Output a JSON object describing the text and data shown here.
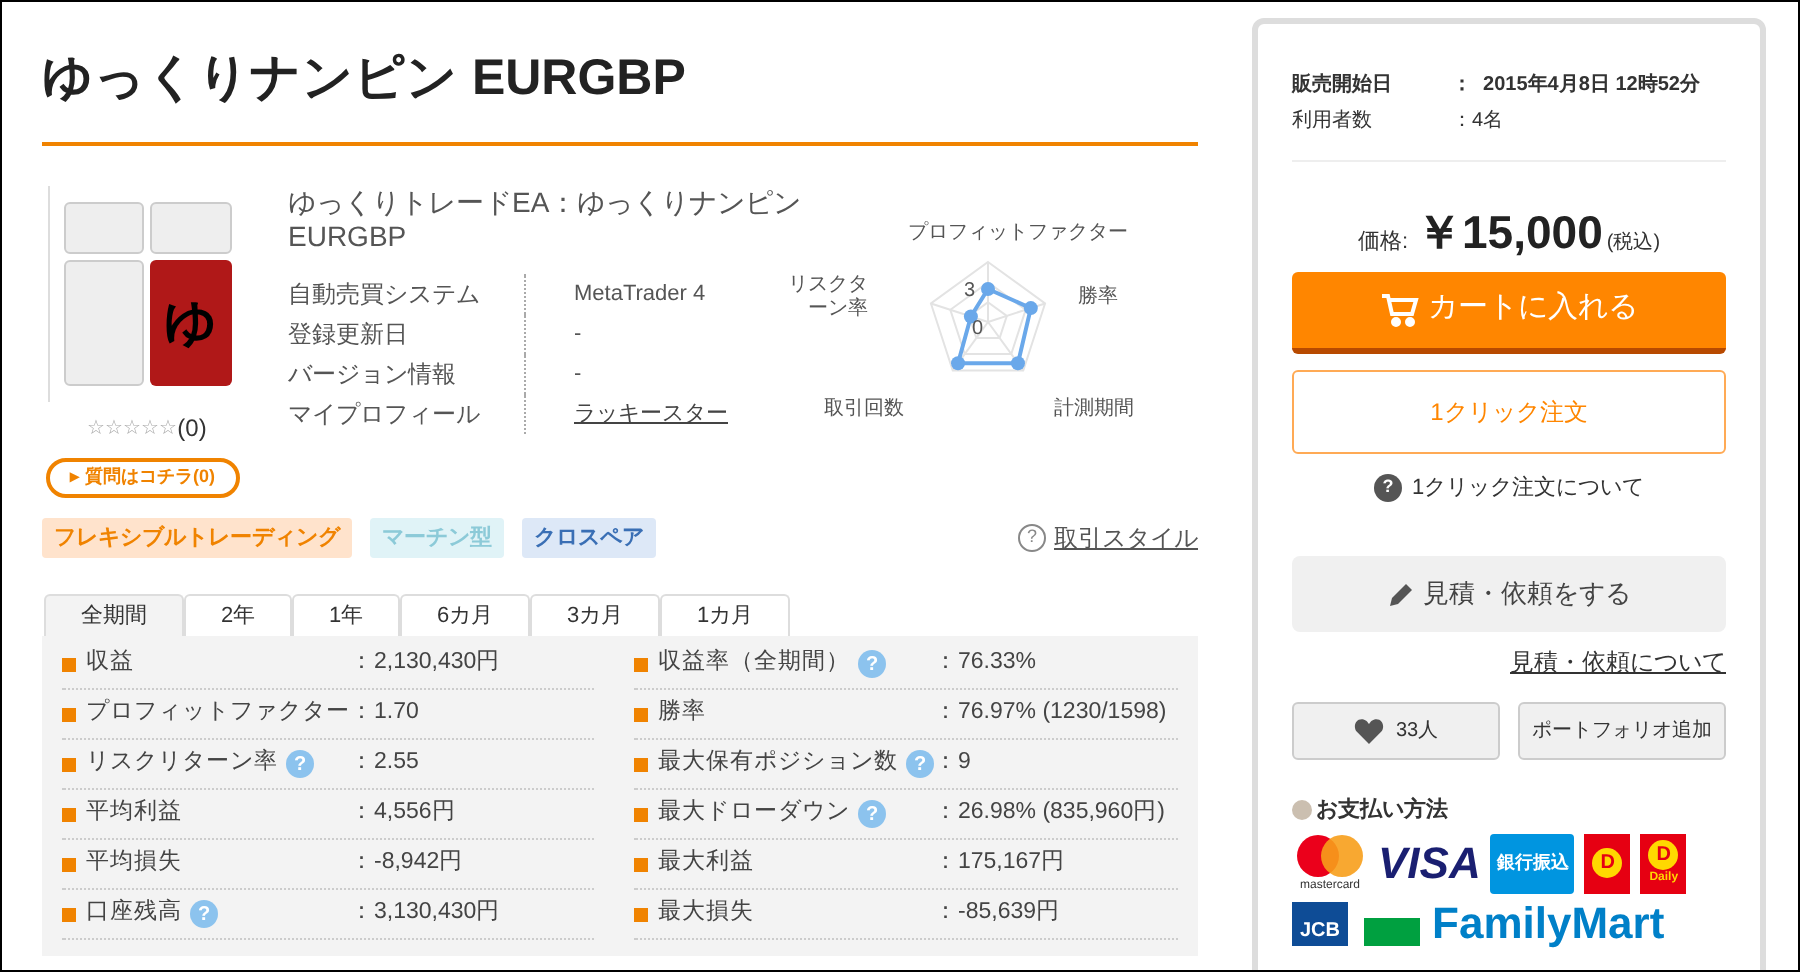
{
  "title": "ゆっくりナンピン EURGBP",
  "product": {
    "name": "ゆっくりトレードEA：ゆっくりナンピン EURGBP",
    "icon_letter": "ゆ",
    "stars": 0,
    "review_count": "(0)",
    "question_button": "質問はコチラ(0)",
    "question_arrow": "▸",
    "help_symbol": "?",
    "specs": [
      {
        "label": "自動売買システム",
        "value": "MetaTrader 4",
        "link": false
      },
      {
        "label": "登録更新日",
        "value": "-",
        "link": false
      },
      {
        "label": "バージョン情報",
        "value": "-",
        "link": false
      },
      {
        "label": "マイプロフィール",
        "value": "ラッキースター",
        "link": true
      }
    ]
  },
  "radar": {
    "labels": [
      "プロフィットファクター",
      "勝率",
      "計測期間",
      "取引回数",
      "リスクターン率"
    ],
    "ticks": [
      "3",
      "0"
    ]
  },
  "tags": [
    {
      "label": "フレキシブルトレーディング",
      "color": "#ffe3cc"
    },
    {
      "label": "マーチン型",
      "color": "#e0f3f7"
    },
    {
      "label": "クロスペア",
      "color": "#dde8f7"
    }
  ],
  "style_link": "取引スタイル",
  "tabs": [
    {
      "label": "全期間",
      "selected": true
    },
    {
      "label": "2年",
      "selected": false
    },
    {
      "label": "1年",
      "selected": false
    },
    {
      "label": "6カ月",
      "selected": false
    },
    {
      "label": "3カ月",
      "selected": false
    },
    {
      "label": "1カ月",
      "selected": false
    }
  ],
  "stats_left": [
    {
      "label": "収益",
      "value": "：2,130,430円",
      "help": false
    },
    {
      "label": "プロフィットファクター",
      "value": "：1.70",
      "help": false
    },
    {
      "label": "リスクリターン率",
      "value": "：2.55",
      "help": true
    },
    {
      "label": "平均利益",
      "value": "：4,556円",
      "help": false
    },
    {
      "label": "平均損失",
      "value": "：-8,942円",
      "help": false
    },
    {
      "label": "口座残高",
      "value": "：3,130,430円",
      "help": true
    }
  ],
  "stats_right": [
    {
      "label": "収益率（全期間）",
      "value": "：76.33%",
      "help": true
    },
    {
      "label": "勝率",
      "value": "：76.97% (1230/1598)",
      "help": false
    },
    {
      "label": "最大保有ポジション数",
      "value": "：9",
      "help": true
    },
    {
      "label": "最大ドローダウン",
      "value": "：26.98% (835,960円)",
      "help": true
    },
    {
      "label": "最大利益",
      "value": "：175,167円",
      "help": false
    },
    {
      "label": "最大損失",
      "value": "：-85,639円",
      "help": false
    }
  ],
  "sidebar": {
    "info": [
      {
        "label": "販売開始日",
        "value": "：  2015年4月8日 12時52分",
        "bold": true
      },
      {
        "label": "利用者数",
        "value": "：4名",
        "bold": false
      }
    ],
    "price_label": "価格:",
    "price": "￥15,000",
    "tax": "(税込)",
    "cart_button": "カートに入れる",
    "one_click_button": "1クリック注文",
    "one_click_help": "1クリック注文について",
    "quote_button": "見積・依頼をする",
    "quote_link": "見積・依頼について",
    "like_count": "33人",
    "portfolio_button": "ポートフォリオ追加",
    "payment_title": "お支払い方法",
    "payments": [
      {
        "kind": "mastercard",
        "text": "mastercard"
      },
      {
        "kind": "visa",
        "text": "VISA"
      },
      {
        "kind": "bank",
        "text": "銀行振込"
      },
      {
        "kind": "d",
        "letter": "D"
      },
      {
        "kind": "d",
        "letter": "D",
        "text": "Daily"
      },
      {
        "kind": "jcb",
        "text": "JCB"
      },
      {
        "kind": "famima",
        "text": "FamilyMart"
      }
    ]
  }
}
